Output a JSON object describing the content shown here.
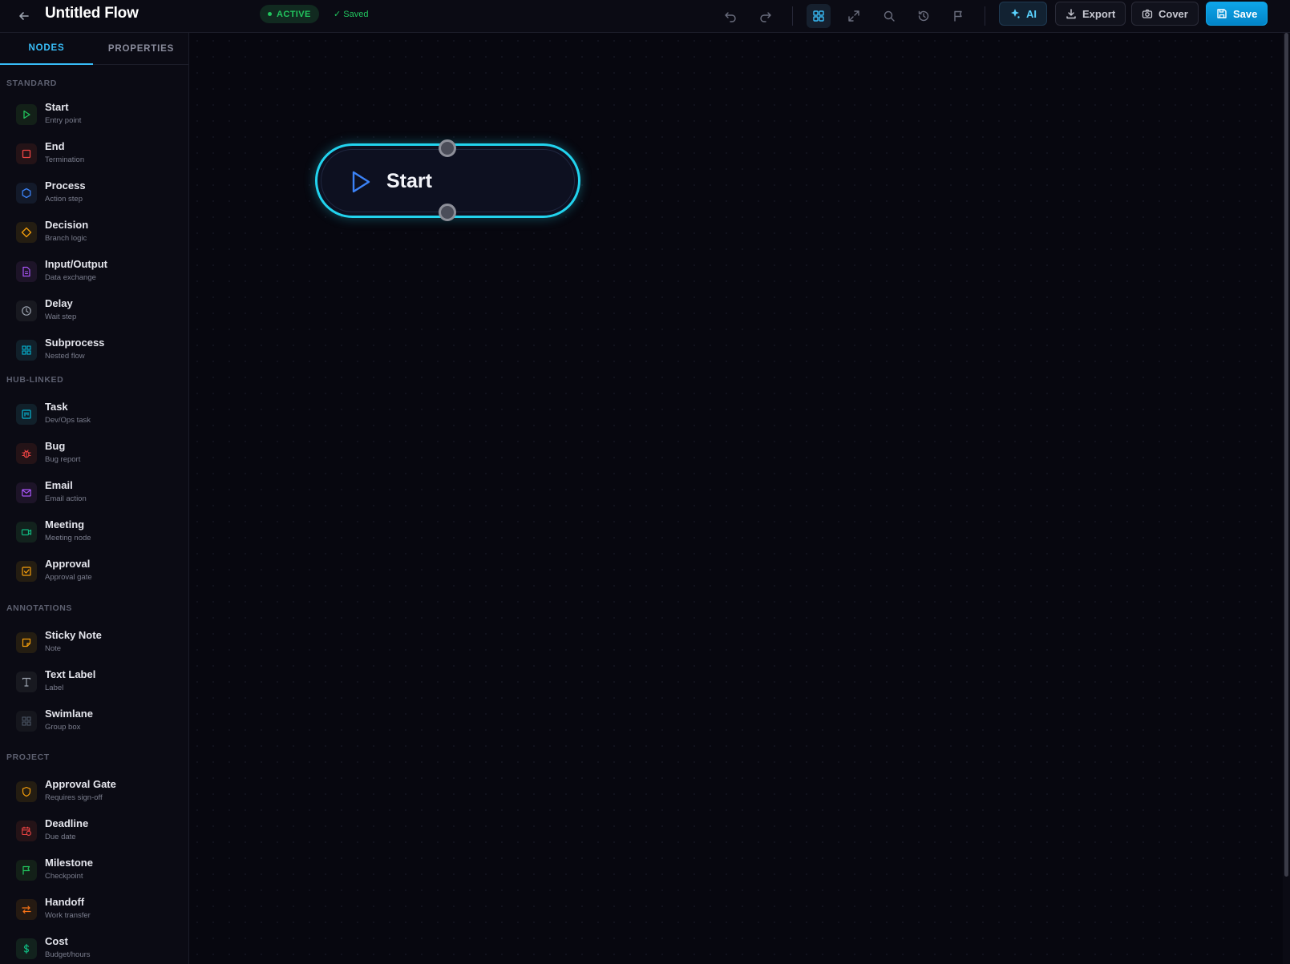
{
  "header": {
    "title": "Untitled Flow",
    "status": "ACTIVE",
    "saved": "✓ Saved",
    "buttons": {
      "ai": "AI",
      "export": "Export",
      "cover": "Cover",
      "save": "Save"
    }
  },
  "sidebar": {
    "tabs": [
      "NODES",
      "PROPERTIES"
    ],
    "sections": [
      {
        "title": "STANDARD",
        "items": [
          {
            "label": "Start",
            "sub": "Entry point",
            "icon": "play-icon",
            "color": "#22c55e"
          },
          {
            "label": "End",
            "sub": "Termination",
            "icon": "square-icon",
            "color": "#ef4444"
          },
          {
            "label": "Process",
            "sub": "Action step",
            "icon": "hexagon-icon",
            "color": "#3b82f6"
          },
          {
            "label": "Decision",
            "sub": "Branch logic",
            "icon": "diamond-icon",
            "color": "#f59e0b"
          },
          {
            "label": "Input/Output",
            "sub": "Data exchange",
            "icon": "file-icon",
            "color": "#a855f7"
          },
          {
            "label": "Delay",
            "sub": "Wait step",
            "icon": "clock-icon",
            "color": "#9ca3af"
          },
          {
            "label": "Subprocess",
            "sub": "Nested flow",
            "icon": "grid-icon",
            "color": "#06b6d4"
          }
        ]
      },
      {
        "title": "HUB-LINKED",
        "items": [
          {
            "label": "Task",
            "sub": "Dev/Ops task",
            "icon": "kanban-icon",
            "color": "#06b6d4"
          },
          {
            "label": "Bug",
            "sub": "Bug report",
            "icon": "bug-icon",
            "color": "#ef4444"
          },
          {
            "label": "Email",
            "sub": "Email action",
            "icon": "mail-icon",
            "color": "#a855f7"
          },
          {
            "label": "Meeting",
            "sub": "Meeting node",
            "icon": "video-icon",
            "color": "#10b981"
          },
          {
            "label": "Approval",
            "sub": "Approval gate",
            "icon": "check-square-icon",
            "color": "#f59e0b"
          }
        ]
      },
      {
        "title": "ANNOTATIONS",
        "items": [
          {
            "label": "Sticky Note",
            "sub": "Note",
            "icon": "sticky-note-icon",
            "color": "#f59e0b"
          },
          {
            "label": "Text Label",
            "sub": "Label",
            "icon": "type-icon",
            "color": "#9ca3af"
          },
          {
            "label": "Swimlane",
            "sub": "Group box",
            "icon": "grid-icon",
            "color": "#4b5563"
          }
        ]
      },
      {
        "title": "PROJECT",
        "items": [
          {
            "label": "Approval Gate",
            "sub": "Requires sign-off",
            "icon": "shield-icon",
            "color": "#f59e0b"
          },
          {
            "label": "Deadline",
            "sub": "Due date",
            "icon": "calendar-clock-icon",
            "color": "#ef4444"
          },
          {
            "label": "Milestone",
            "sub": "Checkpoint",
            "icon": "flag-icon",
            "color": "#22c55e"
          },
          {
            "label": "Handoff",
            "sub": "Work transfer",
            "icon": "swap-icon",
            "color": "#f97316"
          },
          {
            "label": "Cost",
            "sub": "Budget/hours",
            "icon": "dollar-icon",
            "color": "#10b981"
          }
        ]
      }
    ]
  },
  "canvas": {
    "node": {
      "label": "Start",
      "type": "start",
      "accent": "#22d3ee",
      "icon_color": "#3b82f6"
    }
  }
}
